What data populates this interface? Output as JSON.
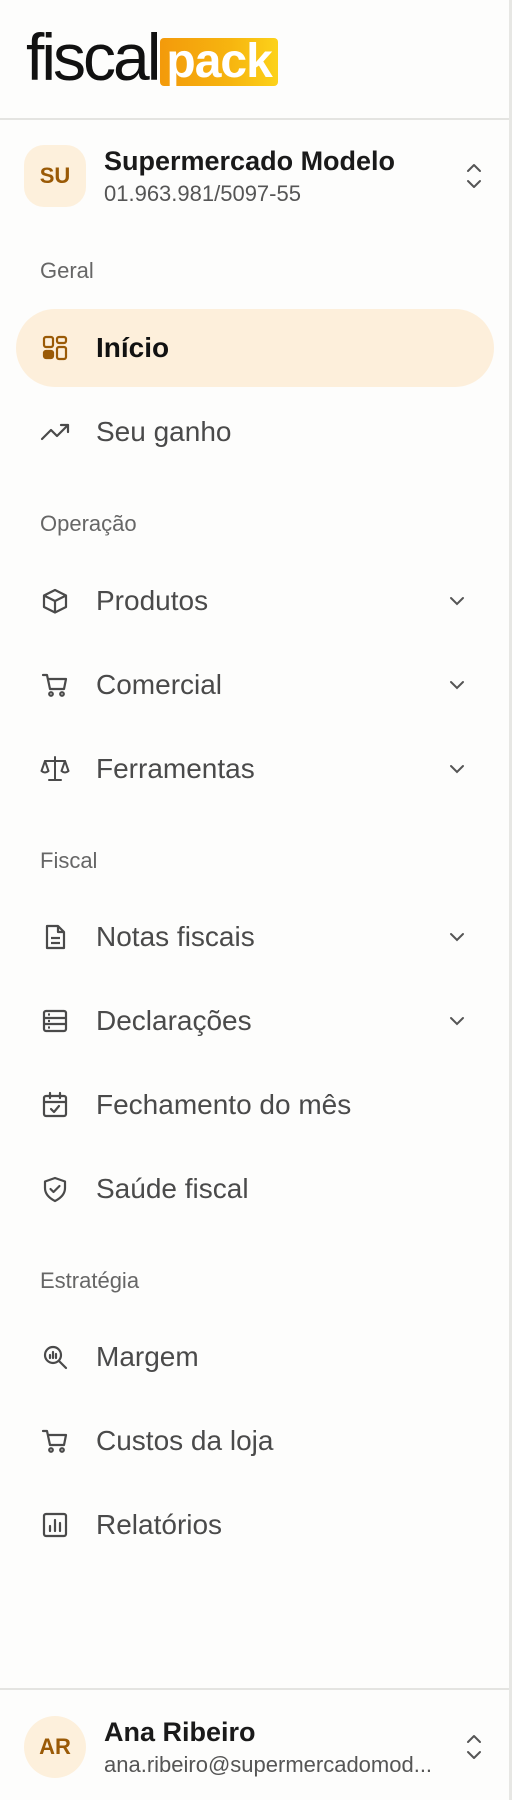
{
  "brand": {
    "logo_part1": "fiscal",
    "logo_part2": "pack",
    "logo_colors": [
      "#f39a0b",
      "#fcd21a"
    ]
  },
  "organization": {
    "initials": "SU",
    "name": "Supermercado Modelo",
    "cnpj": "01.963.981/5097-55"
  },
  "sections": {
    "geral": "Geral",
    "operacao": "Operação",
    "fiscal": "Fiscal",
    "estrategia": "Estratégia"
  },
  "nav": {
    "inicio": {
      "label": "Início",
      "icon": "dashboard-icon",
      "active": true
    },
    "seu_ganho": {
      "label": "Seu ganho",
      "icon": "trending-up-icon"
    },
    "produtos": {
      "label": "Produtos",
      "icon": "box-icon",
      "expandable": true
    },
    "comercial": {
      "label": "Comercial",
      "icon": "cart-icon",
      "expandable": true
    },
    "ferramentas": {
      "label": "Ferramentas",
      "icon": "scale-icon",
      "expandable": true
    },
    "notas_fiscais": {
      "label": "Notas fiscais",
      "icon": "file-text-icon",
      "expandable": true
    },
    "declaracoes": {
      "label": "Declarações",
      "icon": "server-icon",
      "expandable": true
    },
    "fechamento": {
      "label": "Fechamento do mês",
      "icon": "calendar-check-icon"
    },
    "saude_fiscal": {
      "label": "Saúde fiscal",
      "icon": "shield-check-icon"
    },
    "margem": {
      "label": "Margem",
      "icon": "search-chart-icon"
    },
    "custos": {
      "label": "Custos da loja",
      "icon": "cart-icon"
    },
    "relatorios": {
      "label": "Relatórios",
      "icon": "bar-chart-icon"
    }
  },
  "user": {
    "initials": "AR",
    "name": "Ana Ribeiro",
    "email": "ana.ribeiro@supermercadomod..."
  },
  "colors": {
    "accent_bg": "#fdefdb",
    "accent_text": "#9a5a06"
  }
}
